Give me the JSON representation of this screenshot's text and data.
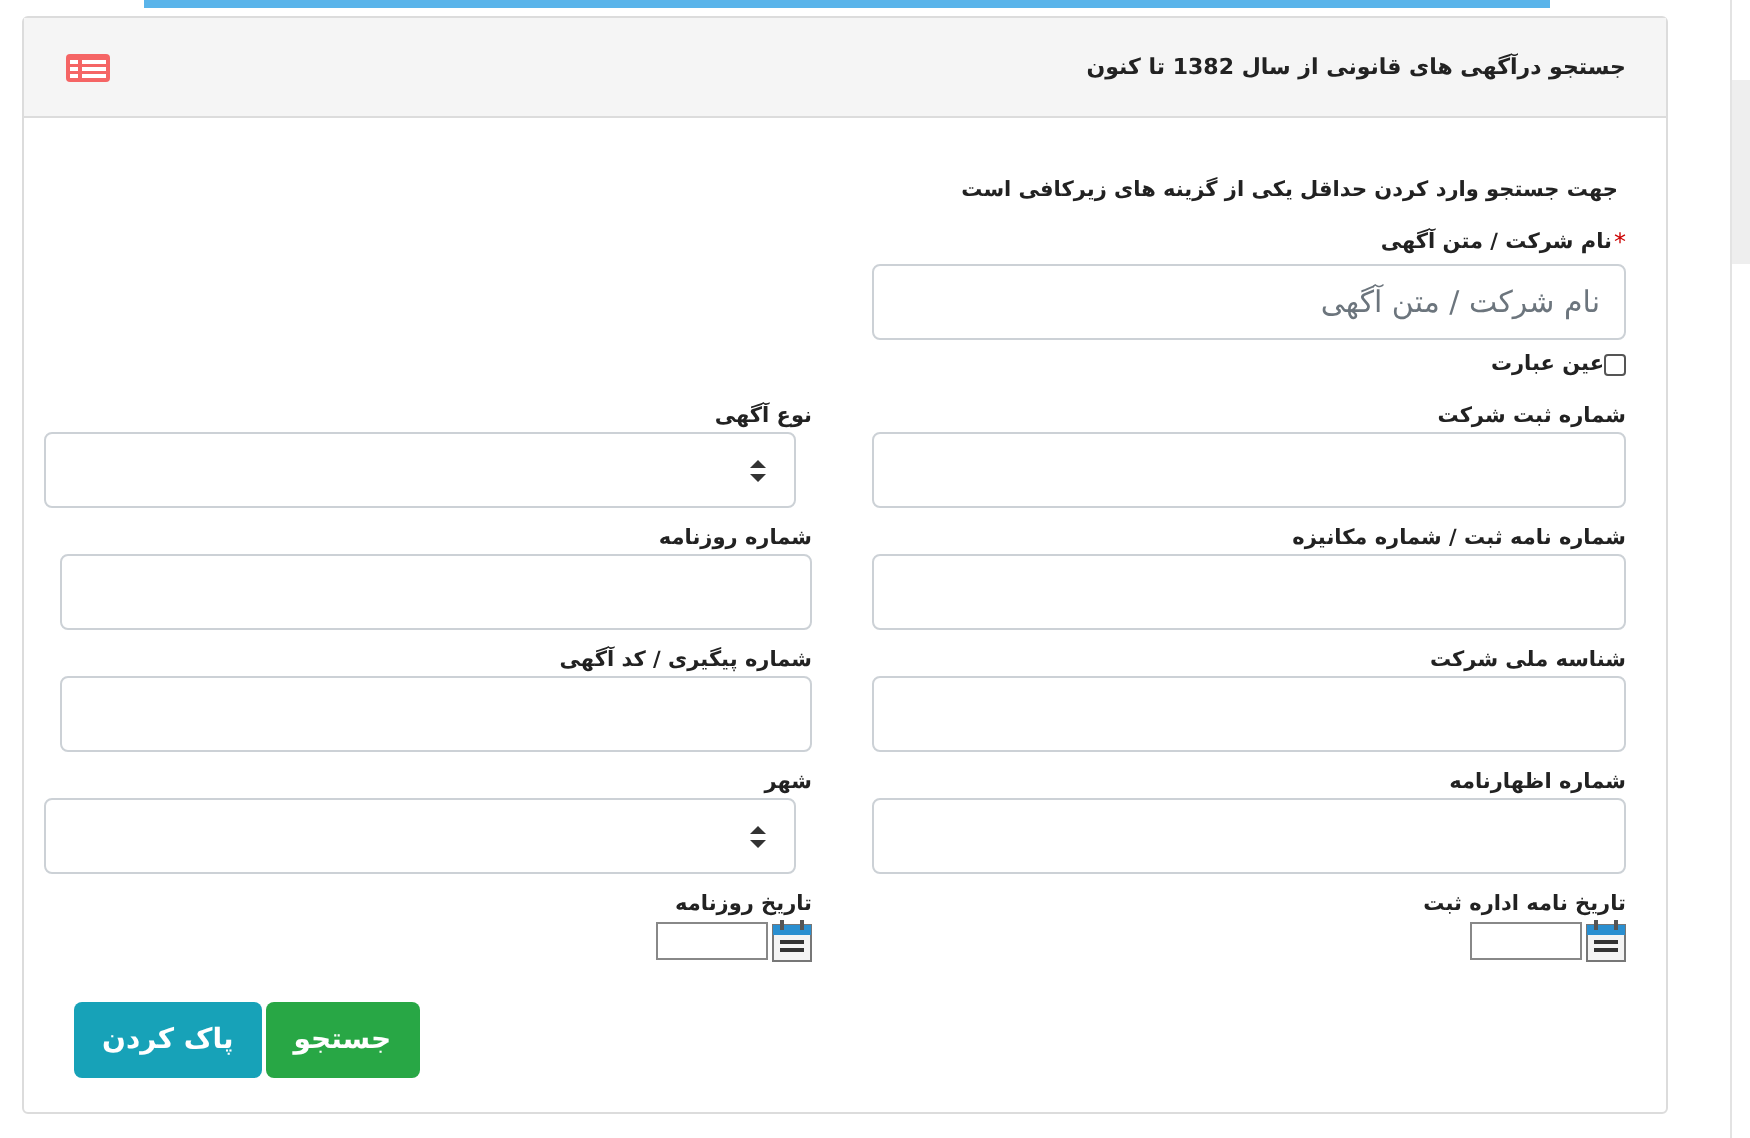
{
  "panel": {
    "title": "جستجو درآگهی های قانونی از سال 1382 تا کنون"
  },
  "note": "جهت جستجو وارد کردن حداقل یکی از گزینه های زیرکافی است",
  "main_field": {
    "label": "نام شرکت / متن آگهی",
    "required": true,
    "required_mark": "*",
    "placeholder": "نام شرکت / متن آگهی"
  },
  "exact_phrase": {
    "label": "عین عبارت",
    "checked": false
  },
  "fields": [
    {
      "label": "شماره ثبت شرکت",
      "kind": "text"
    },
    {
      "label": "نوع آگهی",
      "kind": "select"
    },
    {
      "label": "شماره نامه ثبت / شماره مکانیزه",
      "kind": "text"
    },
    {
      "label": "شماره روزنامه",
      "kind": "text"
    },
    {
      "label": "شناسه ملی شرکت",
      "kind": "text"
    },
    {
      "label": "شماره پیگیری / کد آگهی",
      "kind": "text"
    },
    {
      "label": "شماره اظهارنامه",
      "kind": "text"
    },
    {
      "label": "شهر",
      "kind": "select"
    },
    {
      "label": "تاریخ نامه اداره ثبت",
      "kind": "date"
    },
    {
      "label": "تاریخ روزنامه",
      "kind": "date"
    }
  ],
  "buttons": [
    {
      "label": "جستجو",
      "kind": "success"
    },
    {
      "label": "پاک کردن",
      "kind": "info"
    }
  ]
}
